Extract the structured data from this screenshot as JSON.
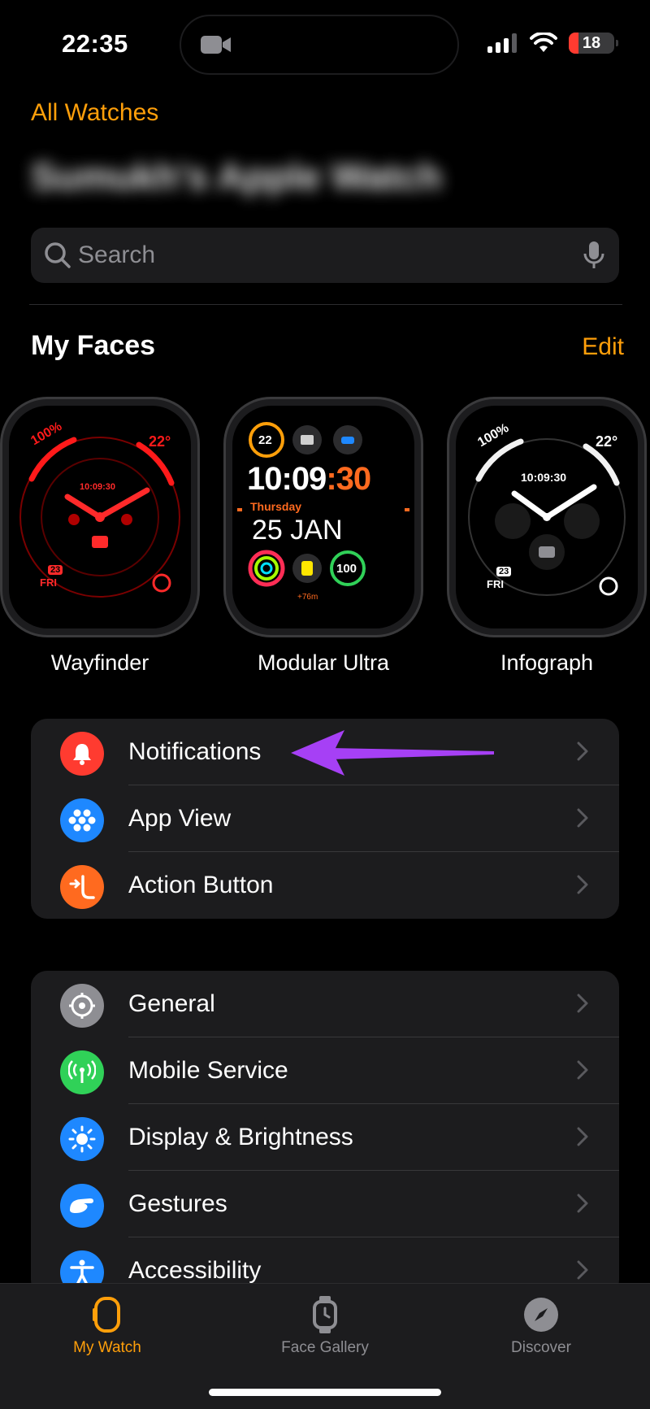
{
  "status_bar": {
    "time": "22:35",
    "battery": "18"
  },
  "nav": {
    "back_label": "All Watches",
    "watch_name": "Sumukh's Apple Watch"
  },
  "search": {
    "placeholder": "Search"
  },
  "my_faces": {
    "title": "My Faces",
    "edit_label": "Edit",
    "faces": [
      {
        "label": "Wayfinder",
        "time": "10:09:30",
        "pct": "100%",
        "temp": "22°",
        "day": "FRI",
        "date": "23"
      },
      {
        "label": "Modular Ultra",
        "time_hm": "10:09",
        "time_s": ":30",
        "day": "Thursday",
        "date": "25 JAN",
        "comp_top": "22",
        "comp_bottom": "100",
        "elev": "+76m"
      },
      {
        "label": "Infograph",
        "time": "10:09:30",
        "pct": "100%",
        "temp": "22°",
        "day": "FRI",
        "date": "23"
      }
    ]
  },
  "group1": [
    {
      "label": "Notifications",
      "icon": "bell-icon",
      "color": "#ff3b30"
    },
    {
      "label": "App View",
      "icon": "app-grid-icon",
      "color": "#1e88ff"
    },
    {
      "label": "Action Button",
      "icon": "action-button-icon",
      "color": "#ff6a1f"
    }
  ],
  "group2": [
    {
      "label": "General",
      "icon": "gear-icon",
      "color": "#8e8e93"
    },
    {
      "label": "Mobile Service",
      "icon": "antenna-icon",
      "color": "#30d158"
    },
    {
      "label": "Display & Brightness",
      "icon": "sun-icon",
      "color": "#1e88ff"
    },
    {
      "label": "Gestures",
      "icon": "hand-icon",
      "color": "#1e88ff"
    },
    {
      "label": "Accessibility",
      "icon": "accessibility-icon",
      "color": "#1e88ff"
    }
  ],
  "tabbar": {
    "tabs": [
      {
        "label": "My Watch",
        "icon": "watch-icon",
        "active": true
      },
      {
        "label": "Face Gallery",
        "icon": "watch-face-icon",
        "active": false
      },
      {
        "label": "Discover",
        "icon": "compass-icon",
        "active": false
      }
    ]
  },
  "colors": {
    "accent": "#ff9f0a",
    "annotation_arrow": "#a640f5"
  }
}
